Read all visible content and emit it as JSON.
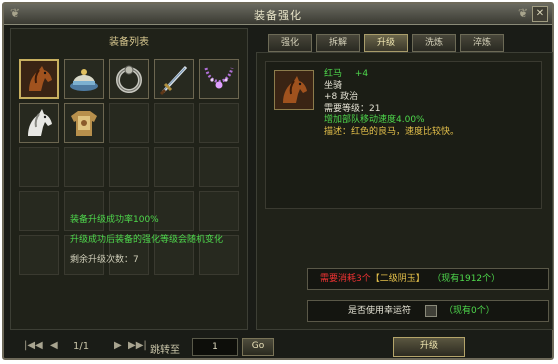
{
  "window": {
    "title": "装备强化"
  },
  "left_panel": {
    "header": "装备列表",
    "items": [
      {
        "icon": "horse-red-icon",
        "selected": true
      },
      {
        "icon": "hat-icon"
      },
      {
        "icon": "ring-icon"
      },
      {
        "icon": "sword-icon"
      },
      {
        "icon": "necklace-icon"
      },
      {
        "icon": "horse-white-icon"
      },
      {
        "icon": "armor-icon"
      }
    ],
    "slots_total": 25
  },
  "pager": {
    "first": "|◀◀",
    "prev": "◀",
    "page_text": "1/1",
    "next": "▶",
    "last": "▶▶|",
    "jump_label": "跳转至",
    "jump_value": "1",
    "go_label": "Go"
  },
  "tabs": [
    {
      "label": "强化"
    },
    {
      "label": "拆解"
    },
    {
      "label": "升级",
      "active": true
    },
    {
      "label": "洗炼"
    },
    {
      "label": "淬炼"
    }
  ],
  "item": {
    "name": "红马",
    "level_plus": "+4",
    "type": "坐骑",
    "stat": "+8 政治",
    "req": "需要等级：21",
    "bonus": "增加部队移动速度4.00%",
    "desc": "描述：红色的良马，速度比较快。"
  },
  "upgrade": {
    "success_rate": "装备升级成功率100%",
    "note": "升级成功后装备的强化等级会随机变化",
    "remaining": "剩余升级次数：7",
    "cost_prefix": "需要消耗3个",
    "cost_item": "【二级阴玉】",
    "cost_have": "（现有1912个）",
    "luck_label": "是否使用幸运符",
    "luck_have": "（现有0个）",
    "button": "升级"
  },
  "colors": {
    "green": "#4ed84c",
    "yellow": "#e4c04a",
    "red": "#ee3232",
    "gold_border": "#c8b060"
  }
}
